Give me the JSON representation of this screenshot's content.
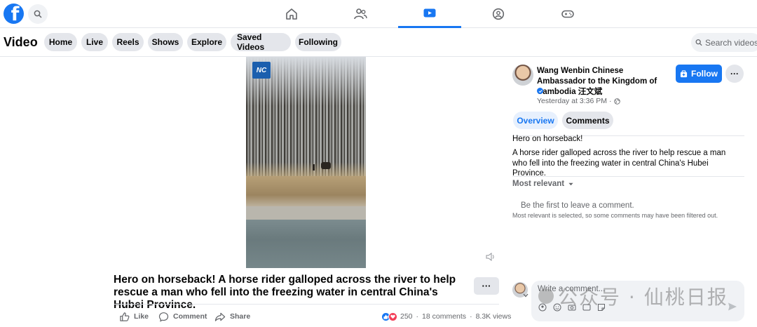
{
  "nav": {
    "logo_letter": "f",
    "tabs": [
      "home",
      "friends",
      "video",
      "groups",
      "gaming"
    ],
    "active_tab": "video"
  },
  "video_header": {
    "title": "Video",
    "pills": [
      "Home",
      "Live",
      "Reels",
      "Shows",
      "Explore",
      "Saved Videos",
      "Following"
    ],
    "search_placeholder": "Search videos"
  },
  "video": {
    "channel_logo_text": "NC"
  },
  "post": {
    "caption": "Hero on horseback! A horse rider galloped across the river to help rescue a man who fell into the freezing water in central China's Hubei Province.",
    "more": "···",
    "actions": {
      "like": "Like",
      "comment": "Comment",
      "share": "Share"
    },
    "reactions_count": "250",
    "comments_count": "18 comments",
    "views_count": "8.3K views",
    "separator": "·"
  },
  "panel": {
    "author": "Wang Wenbin Chinese Ambassador to the Kingdom of Cambodia 汪文斌",
    "time": "Yesterday at 3:36 PM",
    "time_sep": "·",
    "follow": "Follow",
    "more": "···",
    "tabs": {
      "overview": "Overview",
      "comments": "Comments"
    },
    "active_tab": "overview",
    "title": "Hero on horseback!",
    "description": "A horse rider galloped across the river to help rescue a man who fell into the freezing water in central China's Hubei Province.",
    "sort": "Most relevant",
    "empty": "Be the first to leave a comment.",
    "filtered_note": "Most relevant is selected, so some comments may have been filtered out.",
    "comment_placeholder": "Write a comment..."
  },
  "watermark": "公众号 · 仙桃日报",
  "colors": {
    "accent": "#1877f2",
    "pill_bg": "#e4e6eb",
    "muted_text": "#65676b",
    "love": "#f33e58"
  }
}
